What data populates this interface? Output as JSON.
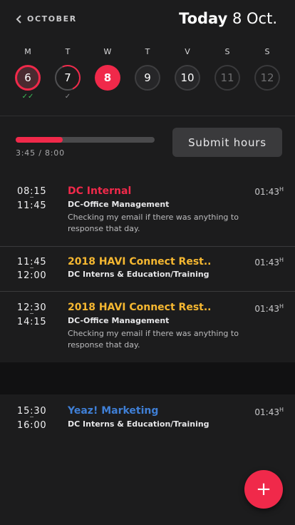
{
  "header": {
    "back_label": "OCTOBER",
    "today_bold": "Today",
    "today_date": "8 Oct."
  },
  "week": [
    {
      "letter": "M",
      "number": "6",
      "check": "✓✓"
    },
    {
      "letter": "T",
      "number": "7",
      "check": "✓"
    },
    {
      "letter": "W",
      "number": "8",
      "check": ""
    },
    {
      "letter": "T",
      "number": "9",
      "check": ""
    },
    {
      "letter": "V",
      "number": "10",
      "check": ""
    },
    {
      "letter": "S",
      "number": "11",
      "check": ""
    },
    {
      "letter": "S",
      "number": "12",
      "check": ""
    }
  ],
  "progress": {
    "text": "3:45 / 8:00",
    "fraction": 0.34
  },
  "submit_label": "Submit hours",
  "entries": [
    {
      "start": "08:15",
      "end": "11:45",
      "title": "DC Internal",
      "title_color": "#f0294a",
      "subtitle": "DC-Office Management",
      "description": "Checking my email if there was anything to response that day.",
      "duration": "01:43",
      "duration_unit": "H"
    },
    {
      "start": "11:45",
      "end": "12:00",
      "title": "2018 HAVI Connect Rest..",
      "title_color": "#f5b731",
      "subtitle": "DC Interns & Education/Training",
      "description": "",
      "duration": "01:43",
      "duration_unit": "H"
    },
    {
      "start": "12:30",
      "end": "14:15",
      "title": "2018 HAVI Connect Rest..",
      "title_color": "#f5b731",
      "subtitle": "DC-Office Management",
      "description": "Checking my email if there was anything to response that day.",
      "duration": "01:43",
      "duration_unit": "H"
    },
    {
      "start": "15:30",
      "end": "16:00",
      "title": "Yeaz! Marketing",
      "title_color": "#3f7fd6",
      "subtitle": "DC Interns & Education/Training",
      "description": "",
      "duration": "01:43",
      "duration_unit": "H"
    }
  ],
  "fab_label": "+",
  "colors": {
    "accent": "#f0294a",
    "background": "#1c1c1d",
    "check_green": "#3fbf5a"
  }
}
